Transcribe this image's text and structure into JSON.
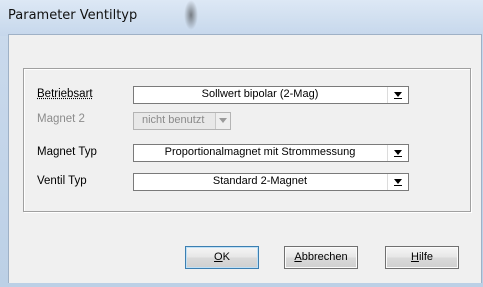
{
  "window": {
    "title": "Parameter Ventiltyp"
  },
  "form": {
    "rows": [
      {
        "label": "Betriebsart",
        "value": "Sollwert bipolar  (2-Mag)",
        "enabled": true
      },
      {
        "label": "Magnet 2",
        "value": "nicht benutzt",
        "enabled": false
      },
      {
        "label": "Magnet Typ",
        "value": "Proportionalmagnet mit Strommessung",
        "enabled": true
      },
      {
        "label": "Ventil Typ",
        "value": "Standard 2-Magnet",
        "enabled": true
      }
    ]
  },
  "buttons": {
    "ok": {
      "mnemonic": "O",
      "rest": "K"
    },
    "cancel": {
      "mnemonic": "A",
      "rest": "bbrechen"
    },
    "help": {
      "mnemonic": "H",
      "rest": "ilfe"
    }
  },
  "icons": {
    "dropdown": "chevron-down-icon"
  }
}
